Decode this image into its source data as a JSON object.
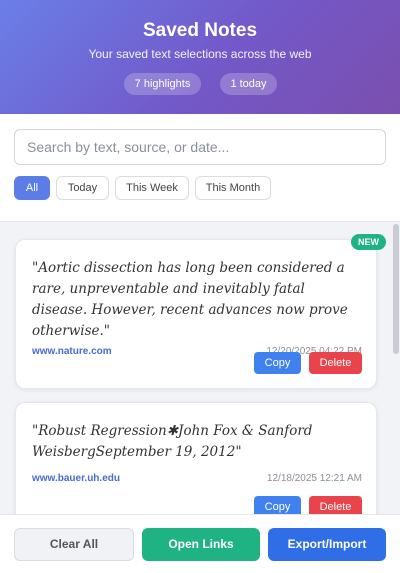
{
  "header": {
    "title": "Saved Notes",
    "subtitle": "Your saved text selections across the web",
    "stats": [
      "7 highlights",
      "1 today"
    ]
  },
  "search": {
    "placeholder": "Search by text, source, or date...",
    "value": ""
  },
  "filters": [
    "All",
    "Today",
    "This Week",
    "This Month"
  ],
  "active_filter": "All",
  "notes": [
    {
      "badge": "NEW",
      "quote": "\"Aortic dissection has long been considered a rare, unpreventable and inevitably fatal disease. However, recent advances now prove otherwise.\"",
      "source": "www.nature.com",
      "date": "12/20/2025 04:22 PM",
      "copy_label": "Copy",
      "delete_label": "Delete"
    },
    {
      "quote": "\"Robust Regression✱John Fox & Sanford WeisbergSeptember 19, 2012\"",
      "source": "www.bauer.uh.edu",
      "date": "12/18/2025 12:21 AM",
      "copy_label": "Copy",
      "delete_label": "Delete"
    }
  ],
  "footer": {
    "clear_label": "Clear All",
    "open_label": "Open Links",
    "export_label": "Export/Import"
  },
  "colors": {
    "accent": "#5b7de6",
    "copy": "#3f82ef",
    "delete": "#e9434b",
    "success": "#1fb383",
    "export": "#2f6ee6"
  }
}
